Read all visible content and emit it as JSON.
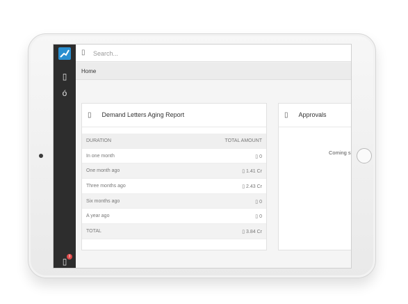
{
  "search": {
    "placeholder": "Search..."
  },
  "breadcrumb": {
    "label": "Home"
  },
  "sidebar": {
    "icons": [
      "menu-icon",
      "user-icon"
    ],
    "notification_count": "3"
  },
  "demand_card": {
    "title": "Demand Letters Aging Report",
    "columns": [
      "DURATION",
      "TOTAL AMOUNT"
    ],
    "rows": [
      {
        "duration": "In one month",
        "amount": "0"
      },
      {
        "duration": "One month ago",
        "amount": "1.41 Cr"
      },
      {
        "duration": "Three months ago",
        "amount": "2.43 Cr"
      },
      {
        "duration": "Six months ago",
        "amount": "0"
      },
      {
        "duration": "A year ago",
        "amount": "0"
      },
      {
        "duration": "TOTAL",
        "amount": "3.84 Cr"
      }
    ]
  },
  "approvals_card": {
    "title": "Approvals",
    "message": "Coming so"
  },
  "colors": {
    "sidebar": "#2d2d2d",
    "logo": "#2a8fd0",
    "badge": "#e04848"
  }
}
